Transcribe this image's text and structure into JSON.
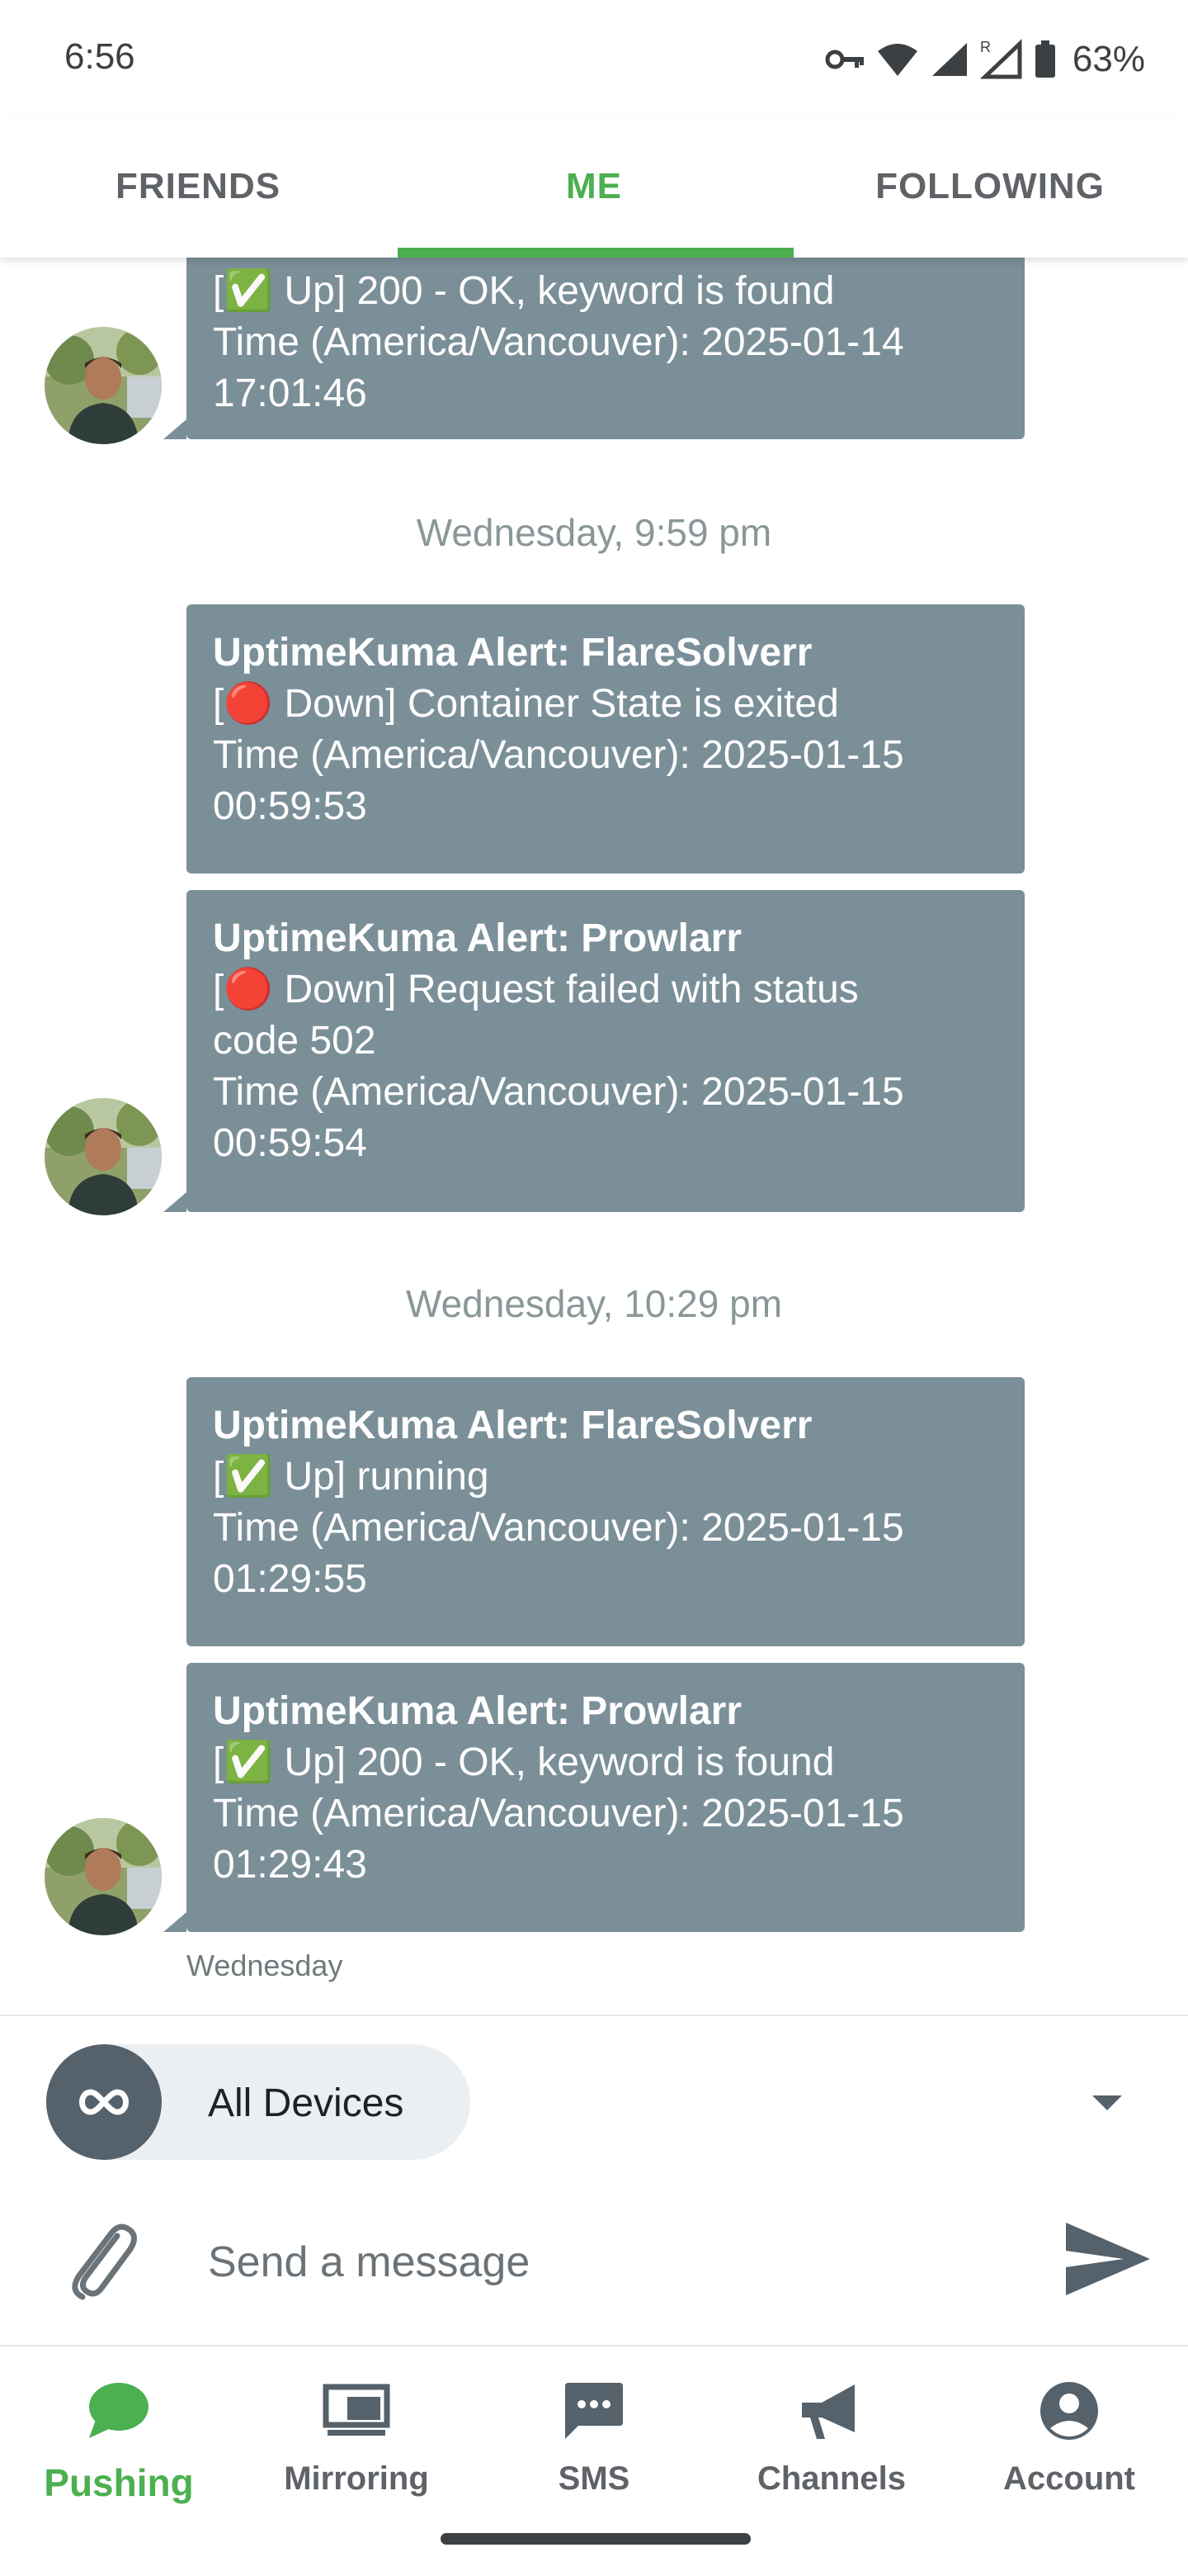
{
  "status_bar": {
    "time": "6:56",
    "battery": "63%"
  },
  "tabs": [
    {
      "label": "FRIENDS",
      "active": false
    },
    {
      "label": "ME",
      "active": true
    },
    {
      "label": "FOLLOWING",
      "active": false
    }
  ],
  "messages": {
    "partial_first": {
      "line1": "[✅ Up] 200 - OK, keyword is found",
      "line2": "Time (America/Vancouver): 2025-01-14",
      "line3": "17:01:46"
    },
    "sep1": "Wednesday, 9:59 pm",
    "msg1": {
      "title": "UptimeKuma Alert: FlareSolverr",
      "line1": "[🔴 Down] Container State is exited",
      "line2": "Time (America/Vancouver): 2025-01-15",
      "line3": "00:59:53"
    },
    "msg2": {
      "title": "UptimeKuma Alert: Prowlarr",
      "line1": "[🔴 Down] Request failed with status",
      "line2": "code 502",
      "line3": "Time (America/Vancouver): 2025-01-15",
      "line4": "00:59:54"
    },
    "sep2": "Wednesday, 10:29 pm",
    "msg3": {
      "title": "UptimeKuma Alert: FlareSolverr",
      "line1": "[✅ Up] running",
      "line2": "Time (America/Vancouver): 2025-01-15",
      "line3": "01:29:55"
    },
    "msg4": {
      "title": "UptimeKuma Alert: Prowlarr",
      "line1": "[✅ Up] 200 - OK, keyword is found",
      "line2": "Time (America/Vancouver): 2025-01-15",
      "line3": "01:29:43"
    },
    "footer": "Wednesday"
  },
  "device_selector": {
    "label": "All Devices"
  },
  "composer": {
    "placeholder": "Send a message"
  },
  "bottom_nav": [
    {
      "label": "Pushing",
      "icon": "chat-bubble-icon",
      "active": true
    },
    {
      "label": "Mirroring",
      "icon": "monitor-icon",
      "active": false
    },
    {
      "label": "SMS",
      "icon": "sms-icon",
      "active": false
    },
    {
      "label": "Channels",
      "icon": "megaphone-icon",
      "active": false
    },
    {
      "label": "Account",
      "icon": "account-circle-icon",
      "active": false
    }
  ],
  "colors": {
    "accent": "#4caf50",
    "bubble": "#7b8f99"
  }
}
